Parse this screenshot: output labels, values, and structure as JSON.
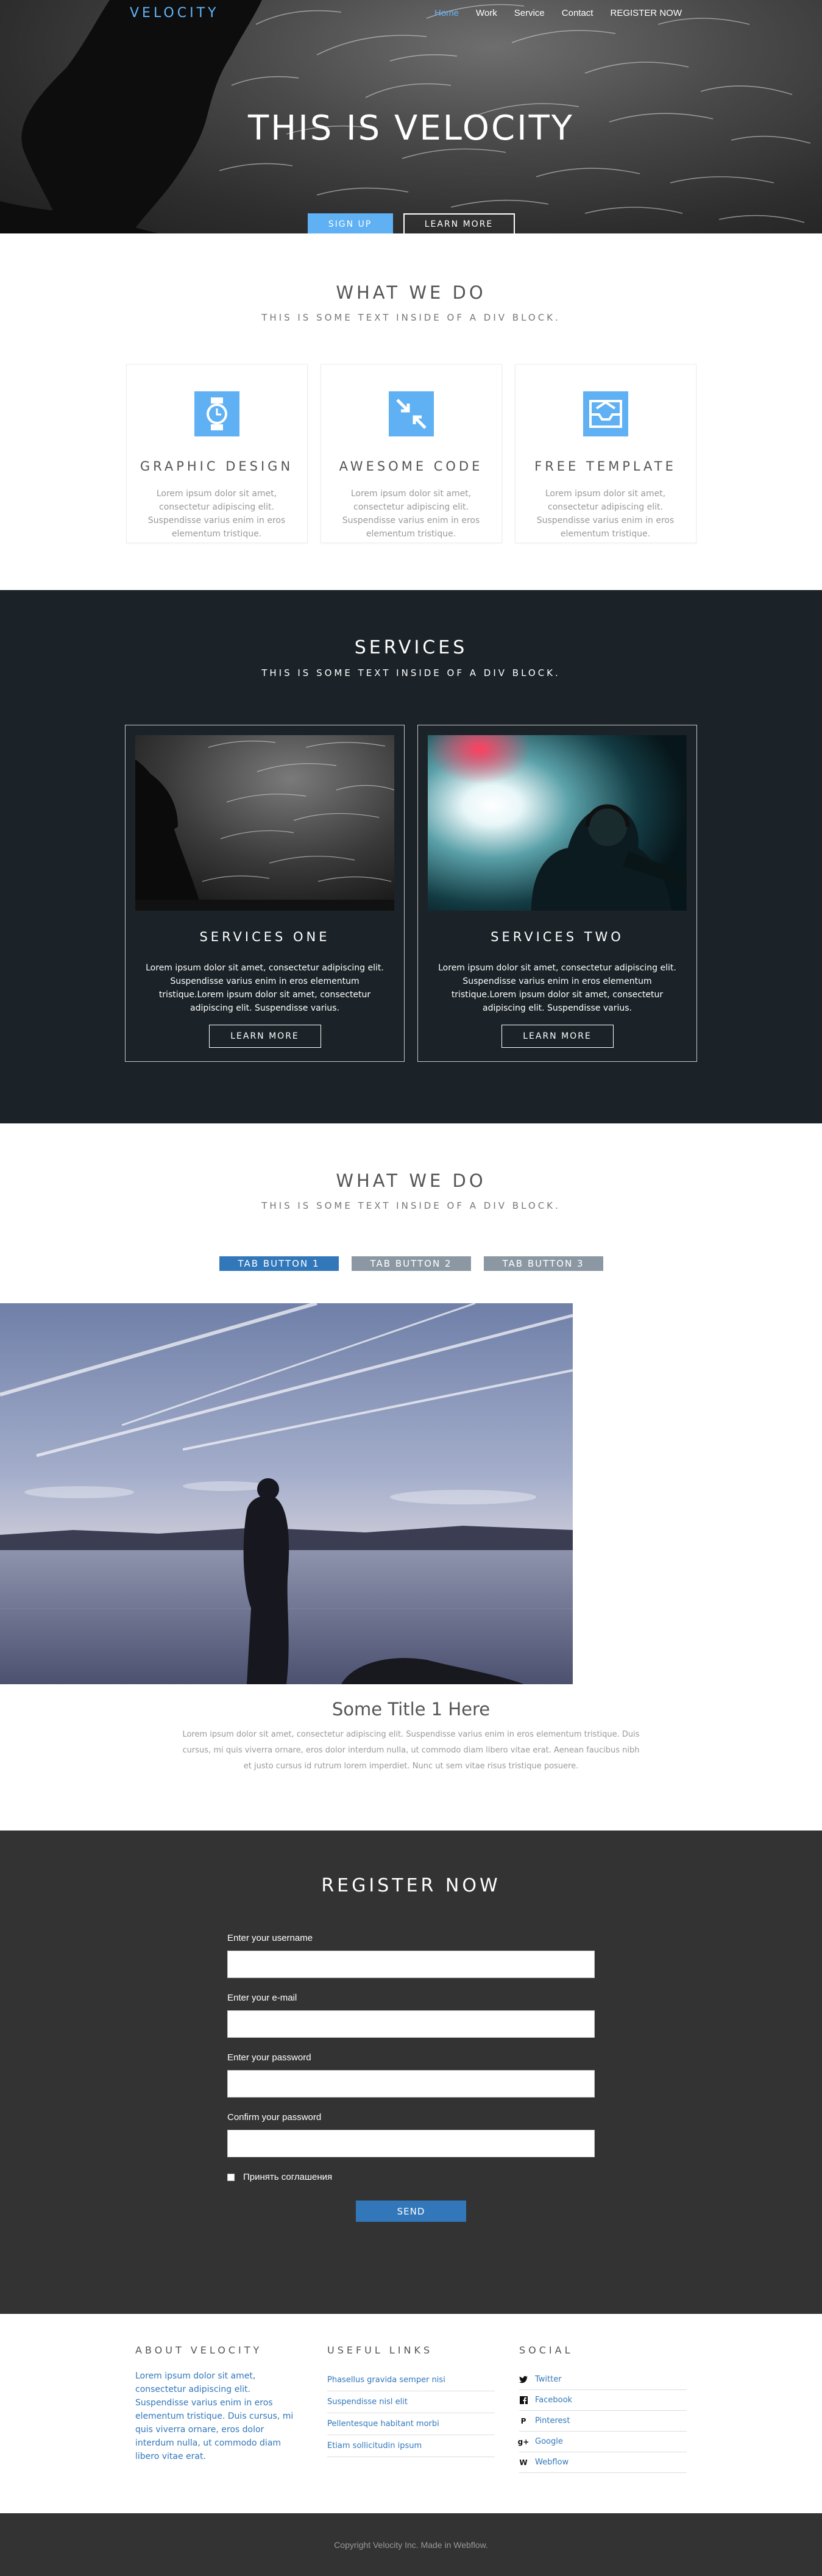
{
  "nav": {
    "brand": "VELOCITY",
    "links": [
      "Home",
      "Work",
      "Service",
      "Contact",
      "REGISTER NOW"
    ]
  },
  "hero": {
    "title": "THIS IS VELOCITY",
    "primary_btn": "SIGN UP",
    "secondary_btn": "LEARN MORE"
  },
  "what_we_do": {
    "title": "WHAT WE DO",
    "subtitle": "THIS IS SOME TEXT INSIDE OF A DIV BLOCK.",
    "features": [
      {
        "title": "GRAPHIC DESIGN",
        "text": "Lorem ipsum dolor sit amet, consectetur adipiscing elit. Suspendisse varius enim in eros elementum tristique."
      },
      {
        "title": "AWESOME CODE",
        "text": "Lorem ipsum dolor sit amet, consectetur adipiscing elit. Suspendisse varius enim in eros elementum tristique."
      },
      {
        "title": "FREE TEMPLATE",
        "text": "Lorem ipsum dolor sit amet, consectetur adipiscing elit. Suspendisse varius enim in eros elementum tristique."
      }
    ]
  },
  "services": {
    "title": "SERVICES",
    "subtitle": "THIS IS SOME TEXT INSIDE OF A DIV BLOCK.",
    "cards": [
      {
        "title": "SERVICES ONE",
        "text": "Lorem ipsum dolor sit amet, consectetur adipiscing elit. Suspendisse varius enim in eros elementum tristique.Lorem ipsum dolor sit amet, consectetur adipiscing elit. Suspendisse varius.",
        "btn": "LEARN MORE"
      },
      {
        "title": "SERVICES TWO",
        "text": "Lorem ipsum dolor sit amet, consectetur adipiscing elit. Suspendisse varius enim in eros elementum tristique.Lorem ipsum dolor sit amet, consectetur adipiscing elit. Suspendisse varius.",
        "btn": "LEARN MORE"
      }
    ]
  },
  "tabs_section": {
    "title": "WHAT WE DO",
    "subtitle": "THIS IS SOME TEXT INSIDE OF A DIV BLOCK.",
    "tabs": [
      "TAB BUTTON 1",
      "TAB BUTTON 2",
      "TAB BUTTON 3"
    ],
    "content_title": "Some Title 1 Here",
    "content_text": "Lorem ipsum dolor sit amet, consectetur adipiscing elit. Suspendisse varius enim in eros elementum tristique. Duis cursus, mi quis viverra ornare, eros dolor interdum nulla, ut commodo diam libero vitae erat. Aenean faucibus nibh et justo cursus id rutrum lorem imperdiet. Nunc ut sem vitae risus tristique posuere."
  },
  "register": {
    "title": "REGISTER NOW",
    "fields": [
      {
        "label": "Enter your username"
      },
      {
        "label": "Enter your e-mail"
      },
      {
        "label": "Enter your password"
      },
      {
        "label": "Confirm your password"
      }
    ],
    "checkbox_label": "Принять соглашения",
    "send": "SEND"
  },
  "footer": {
    "about_title": "ABOUT VELOCITY",
    "about_text": "Lorem ipsum dolor sit amet, consectetur adipiscing elit. Suspendisse varius enim in eros elementum tristique. Duis cursus, mi quis viverra ornare, eros dolor interdum nulla, ut commodo diam libero vitae erat.",
    "links_title": "USEFUL LINKS",
    "links": [
      "Phasellus gravida semper nisi",
      "Suspendisse nisl elit",
      "Pellentesque habitant morbi",
      "Etiam sollicitudin ipsum"
    ],
    "social_title": "SOCIAL",
    "social": [
      {
        "label": "Twitter",
        "icon": "twitter-icon"
      },
      {
        "label": "Facebook",
        "icon": "facebook-icon"
      },
      {
        "label": "Pinterest",
        "icon": "pinterest-icon"
      },
      {
        "label": "Google",
        "icon": "google-plus-icon"
      },
      {
        "label": "Webflow",
        "icon": "webflow-icon"
      }
    ],
    "copyright": "Copyright Velocity Inc. Made in Webflow."
  },
  "colors": {
    "accent": "#5fb1f4",
    "primary_blue": "#3177ba",
    "dark": "#1b2328",
    "charcoal": "#333333"
  }
}
